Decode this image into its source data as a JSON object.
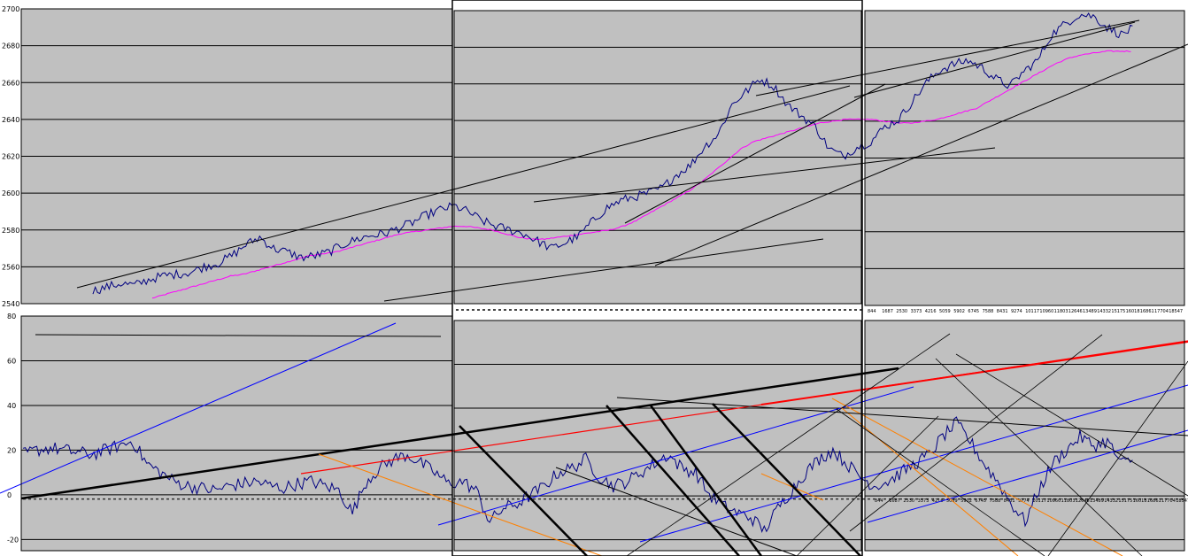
{
  "chart_data": [
    {
      "type": "line",
      "title": "",
      "xlabel": "",
      "ylabel": "",
      "ylim": [
        2540,
        2700
      ],
      "y_ticks": [
        "2540",
        "2560",
        "2580",
        "2600",
        "2620",
        "2640",
        "2660",
        "2680",
        "2700"
      ],
      "x_tick_labels_panel3": [
        "844",
        "1687",
        "2530",
        "3373",
        "4216",
        "5059",
        "5902",
        "6745",
        "7588",
        "8431",
        "9274",
        "10117",
        "10960",
        "11803",
        "12646",
        "13489",
        "14332",
        "15175",
        "16018",
        "16861",
        "17704",
        "18547"
      ],
      "grid": true,
      "background": "#c0c0c0",
      "price_color": "#000080",
      "average_color": "#ff00ff",
      "panels": 3,
      "series": [
        {
          "values": [
            2547,
            2549,
            2551,
            2550,
            2553,
            2555,
            2556,
            2557,
            2560,
            2562,
            2566,
            2572,
            2576,
            2570,
            2568,
            2565,
            2566,
            2568,
            2572,
            2575,
            2577,
            2578,
            2581,
            2584,
            2588,
            2591,
            2593,
            2590,
            2585,
            2582,
            2580,
            2578,
            2574,
            2570,
            2573,
            2577,
            2585,
            2592,
            2596,
            2598,
            2600,
            2603,
            2610,
            2615,
            2625,
            2632,
            2648,
            2655,
            2662,
            2658,
            2648,
            2642,
            2636,
            2624,
            2620,
            2625,
            2628,
            2636,
            2640,
            2650,
            2660,
            2667,
            2670,
            2672,
            2668,
            2662,
            2658,
            2666,
            2672,
            2686,
            2692,
            2697,
            2696,
            2690,
            2686,
            2690
          ]
        },
        {
          "values": [
            2543,
            2545,
            2547,
            2549,
            2551,
            2553,
            2555,
            2556,
            2558,
            2560,
            2562,
            2564,
            2566,
            2567,
            2568,
            2570,
            2572,
            2574,
            2576,
            2578,
            2579,
            2580,
            2581,
            2582,
            2582,
            2581,
            2580,
            2578,
            2576,
            2575,
            2575,
            2576,
            2577,
            2578,
            2579,
            2580,
            2582,
            2585,
            2589,
            2593,
            2597,
            2601,
            2606,
            2612,
            2618,
            2624,
            2628,
            2630,
            2632,
            2634,
            2636,
            2638,
            2639,
            2640,
            2640,
            2640,
            2639,
            2638,
            2638,
            2639,
            2640,
            2642,
            2644,
            2646,
            2650,
            2654,
            2658,
            2662,
            2666,
            2670,
            2673,
            2675,
            2676,
            2677,
            2677,
            2677
          ]
        }
      ]
    },
    {
      "type": "line",
      "title": "",
      "xlabel": "",
      "ylabel": "",
      "ylim": [
        -25,
        80
      ],
      "y_ticks": [
        "-20",
        "0",
        "20",
        "40",
        "60",
        "80"
      ],
      "x_tick_labels_panel3": [
        "844",
        "1687",
        "2530",
        "3373",
        "4216",
        "5059",
        "5902",
        "6745",
        "7588",
        "8431",
        "9274",
        "10117",
        "10960",
        "11803",
        "12646",
        "13489",
        "14332",
        "15175",
        "16018",
        "16861",
        "17704",
        "18547"
      ],
      "grid": true,
      "background": "#c0c0c0",
      "line_color": "#000080",
      "panels": 3,
      "series": [
        {
          "values": [
            18,
            20,
            21,
            20,
            19,
            18,
            20,
            22,
            24,
            14,
            10,
            6,
            4,
            3,
            2,
            4,
            5,
            6,
            4,
            3,
            5,
            6,
            4,
            2,
            -8,
            6,
            12,
            16,
            18,
            14,
            10,
            5,
            6,
            2,
            -12,
            -6,
            -4,
            0,
            4,
            10,
            12,
            16,
            8,
            4,
            6,
            10,
            14,
            18,
            12,
            10,
            0,
            -5,
            -8,
            -10,
            -16,
            -6,
            2,
            10,
            16,
            20,
            14,
            8,
            4,
            6,
            10,
            14,
            18,
            26,
            32,
            24,
            14,
            6,
            -4,
            -12,
            2,
            14,
            20,
            26,
            22,
            24,
            14,
            16
          ]
        }
      ]
    }
  ]
}
